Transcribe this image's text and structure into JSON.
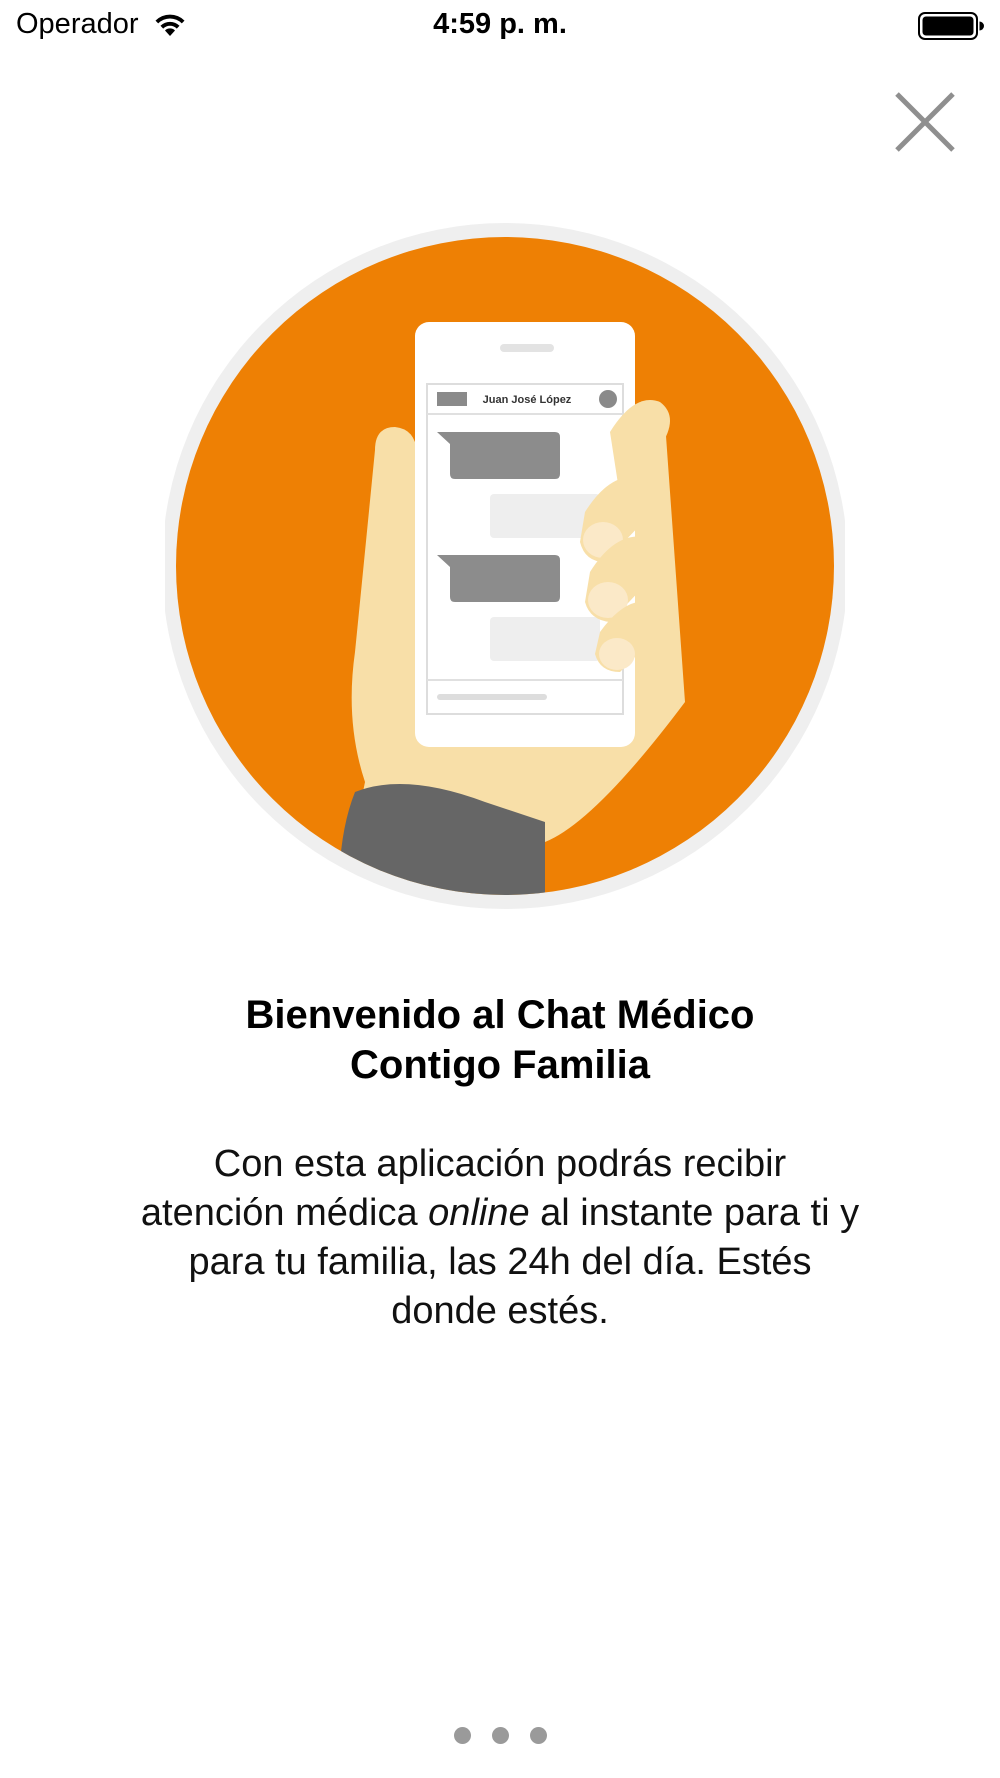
{
  "status_bar": {
    "carrier": "Operador",
    "time": "4:59 p. m.",
    "wifi_icon": "wifi-icon",
    "battery_icon": "battery-full-icon"
  },
  "close_button": {
    "icon": "close-icon",
    "color": "#8f8f8f"
  },
  "illustration": {
    "description_icon": "hand-holding-phone-chat-illustration",
    "circle_color": "#ee8004",
    "ring_color": "#efefef",
    "phone_header_name": "Juan José López"
  },
  "welcome": {
    "title_line1": "Bienvenido al Chat Médico",
    "title_line2": "Contigo Familia",
    "body_line1": "Con esta aplicación podrás recibir",
    "body_line2_pre": "atención médica ",
    "body_line2_em": "online",
    "body_line2_post": " al instante para ti y",
    "body_line3": "para tu familia, las 24h del día. Estés",
    "body_line4": "donde estés."
  },
  "pager": {
    "total_pages": 3,
    "current_page": 1,
    "dot_color": "#9a9a9a"
  }
}
